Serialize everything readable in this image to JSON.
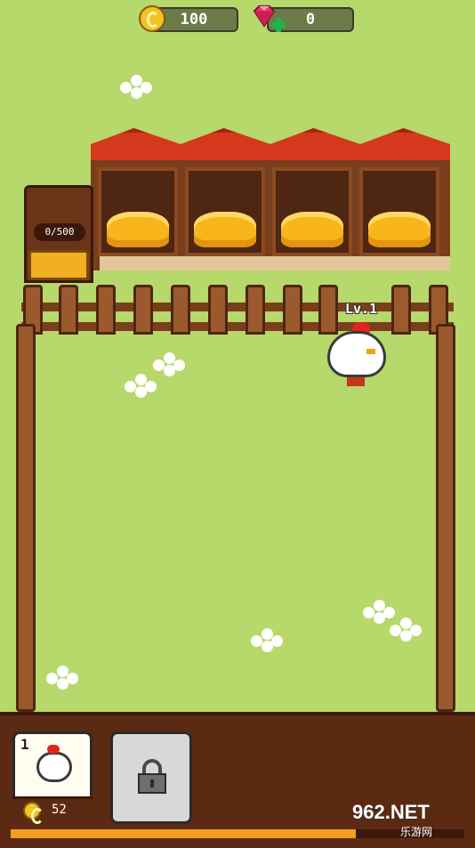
{
  "hud": {
    "coins": "100",
    "gems": "0"
  },
  "feeder": {
    "capacity_label": "0/500"
  },
  "chicken": {
    "level_label": "Lv.1"
  },
  "shop": {
    "slots": [
      {
        "index_label": "1",
        "price": "52",
        "locked": false
      },
      {
        "locked": true
      }
    ]
  },
  "progress": {
    "fraction": 0.76
  },
  "watermark": {
    "brand": "962.NET",
    "sub": "乐游网"
  }
}
